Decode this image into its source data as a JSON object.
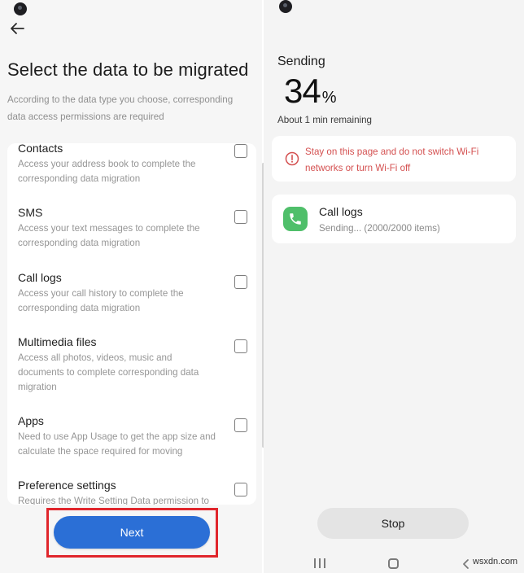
{
  "left_screen": {
    "title": "Select the data to be migrated",
    "subtitle": "According to the data type you choose, corresponding data access permissions are required",
    "items": [
      {
        "label": "Contacts",
        "description": "Access your address book to complete the corresponding data migration",
        "checked": false
      },
      {
        "label": "SMS",
        "description": "Access your text messages to complete the corresponding data migration",
        "checked": false
      },
      {
        "label": "Call logs",
        "description": "Access your call history to complete the corresponding data migration",
        "checked": false
      },
      {
        "label": "Multimedia files",
        "description": "Access all photos, videos, music and documents to complete corresponding data migration",
        "checked": false
      },
      {
        "label": "Apps",
        "description": "Need to use App Usage to get the app size and calculate the space required for moving",
        "checked": false
      },
      {
        "label": "Preference settings",
        "description": "Requires the Write Setting Data permission to",
        "checked": false
      }
    ],
    "next_label": "Next",
    "highlight_color": "#e0262c",
    "accent_color": "#2b6fd6"
  },
  "right_screen": {
    "status_label": "Sending",
    "progress_value": "34",
    "progress_unit": "%",
    "time_remaining": "About 1 min remaining",
    "warning_text": "Stay on this page and do not switch Wi-Fi networks or turn Wi-Fi off",
    "warning_color": "#d45050",
    "transfer_item": {
      "title": "Call logs",
      "status": "Sending... (2000/2000 items)",
      "icon": "phone-icon",
      "icon_color": "#4fbf6a"
    },
    "stop_label": "Stop"
  },
  "icons": {
    "back": "back-arrow-icon",
    "warning": "warning-circle-icon",
    "nav": [
      "recent-apps-icon",
      "home-icon",
      "back-nav-icon"
    ]
  },
  "watermark": "wsxdn.com"
}
